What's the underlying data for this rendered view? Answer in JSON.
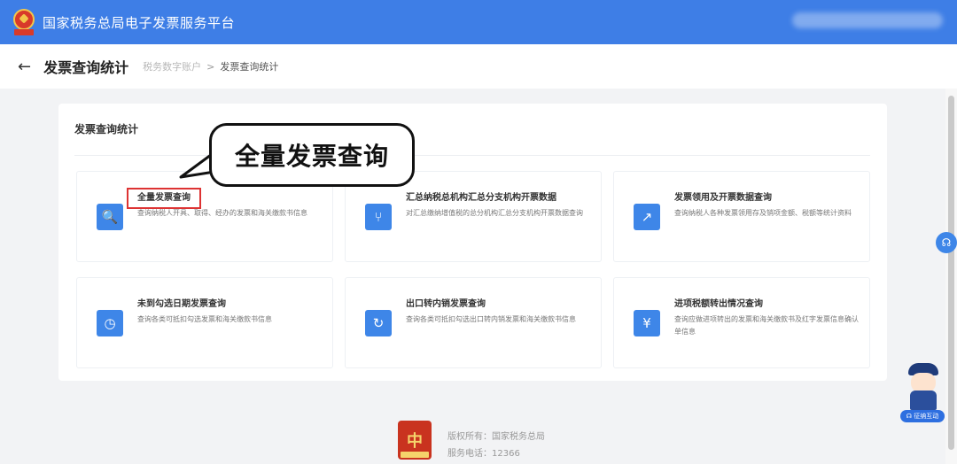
{
  "header": {
    "site_title": "国家税务总局电子发票服务平台",
    "icons": {
      "logo": "tax-emblem-logo"
    },
    "colors": {
      "brand_blue": "#3e7ee6",
      "highlight_red": "#dd3333"
    }
  },
  "subheader": {
    "back_glyph": "←",
    "page_title": "发票查询统计",
    "breadcrumb": [
      "税务数字账户",
      "发票查询统计"
    ],
    "breadcrumb_separator": ">"
  },
  "panel": {
    "title": "发票查询统计",
    "cards": [
      {
        "title": "全量发票查询",
        "desc": "查询纳税人开具、取得、经办的发票和海关缴款书信息",
        "icon": "invoice-search-icon",
        "glyph": "🔍"
      },
      {
        "title": "汇总纳税总机构汇总分支机构开票数据",
        "desc": "对汇总缴纳增值税的总分机构汇总分支机构开票数据查询",
        "icon": "branch-icon",
        "glyph": "⑂"
      },
      {
        "title": "发票领用及开票数据查询",
        "desc": "查询纳税人各种发票领用存及销项金额、税额等统计资料",
        "icon": "chart-icon",
        "glyph": "↗"
      },
      {
        "title": "未到勾选日期发票查询",
        "desc": "查询各类可抵扣勾选发票和海关缴款书信息",
        "icon": "clock-icon",
        "glyph": "◷"
      },
      {
        "title": "出口转内销发票查询",
        "desc": "查询各类可抵扣勾选出口转内销发票和海关缴款书信息",
        "icon": "export-icon",
        "glyph": "↻"
      },
      {
        "title": "进项税额转出情况查询",
        "desc": "查询应做进项转出的发票和海关缴款书及红字发票信息确认单信息",
        "icon": "yuan-icon",
        "glyph": "¥"
      }
    ]
  },
  "callout": {
    "text": "全量发票查询"
  },
  "side": {
    "help_glyph": "☊",
    "mascot_label": "☊ 征纳互动"
  },
  "footer": {
    "logo_glyph": "中",
    "copyright": "版权所有：国家税务总局",
    "phone": "服务电话：12366"
  }
}
